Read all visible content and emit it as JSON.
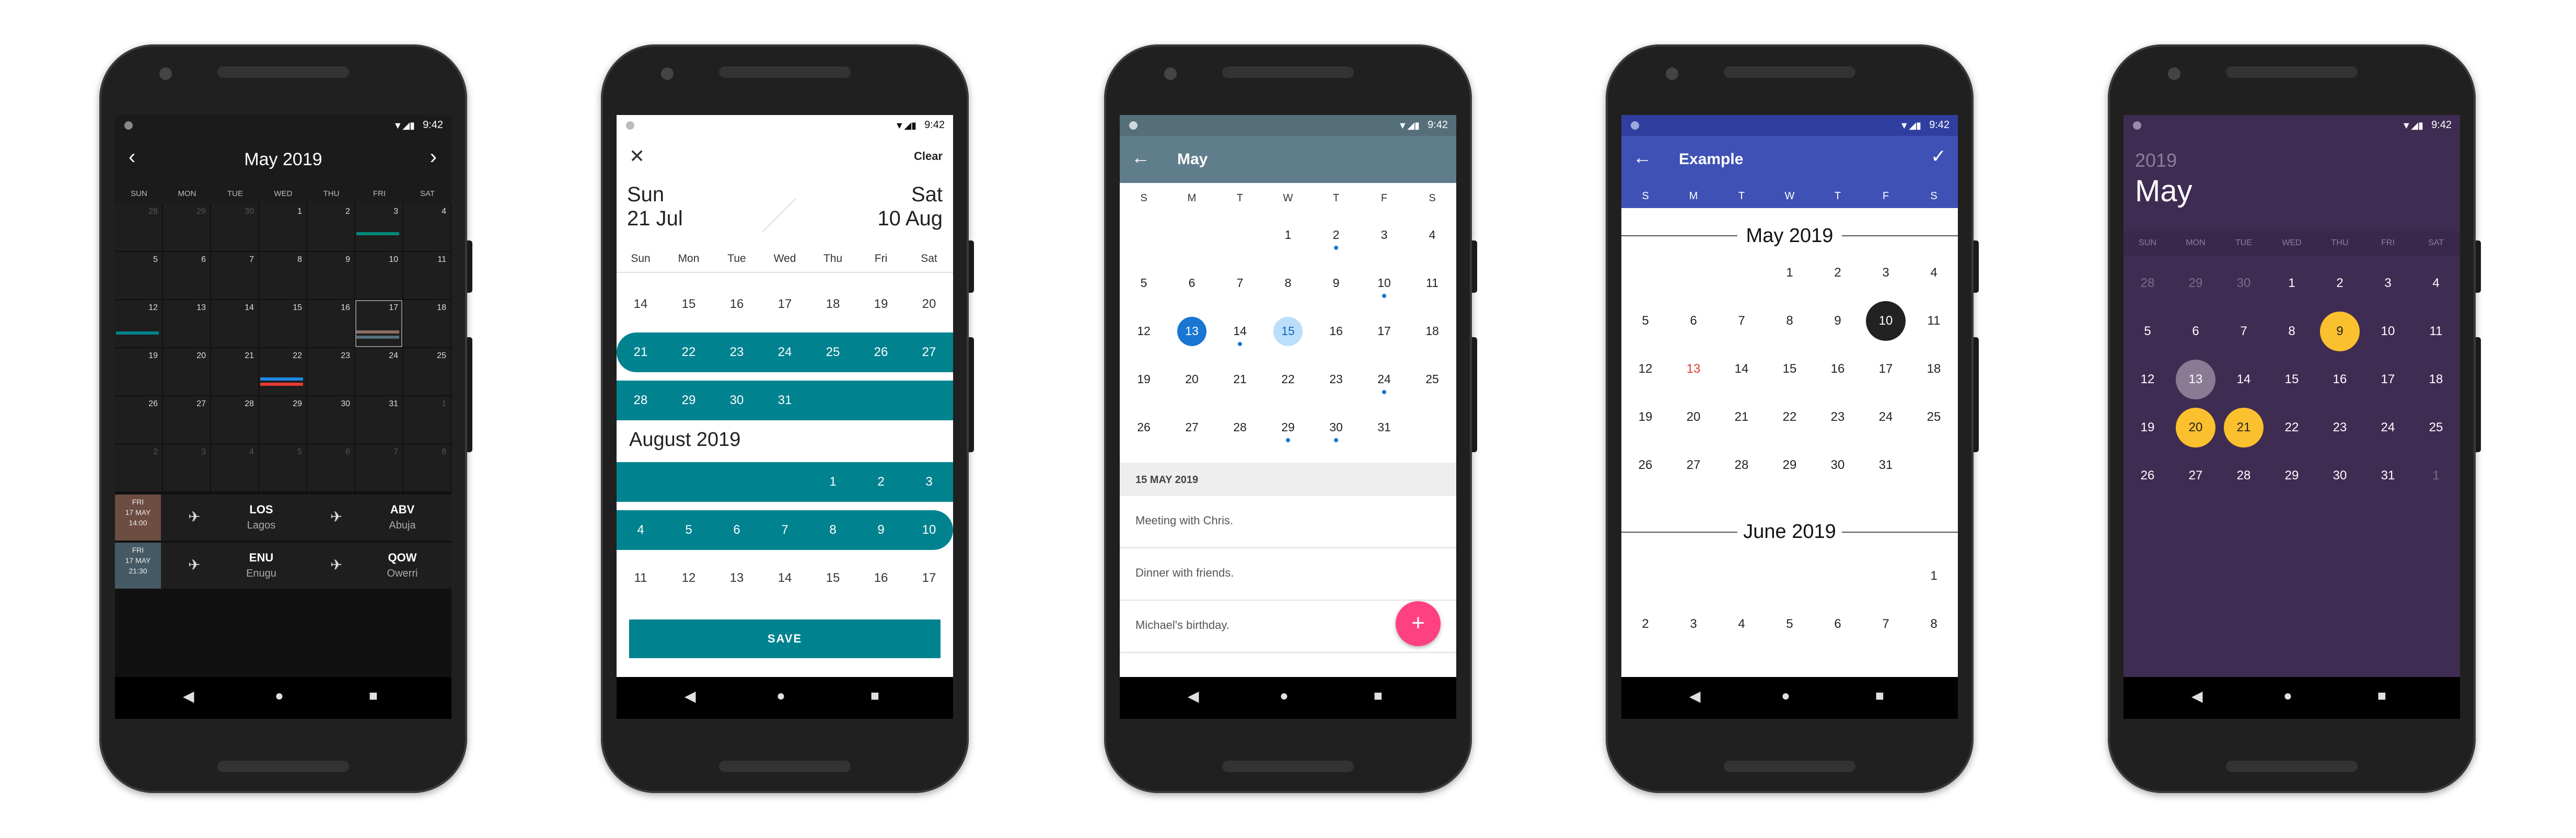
{
  "status": {
    "time": "9:42"
  },
  "dark": {
    "title": "May 2019",
    "dows": [
      "SUN",
      "MON",
      "TUE",
      "WED",
      "THU",
      "FRI",
      "SAT"
    ],
    "weeks": [
      [
        "28",
        "29",
        "30",
        "1",
        "2",
        "3",
        "4"
      ],
      [
        "5",
        "6",
        "7",
        "8",
        "9",
        "10",
        "11"
      ],
      [
        "12",
        "13",
        "14",
        "15",
        "16",
        "17",
        "18"
      ],
      [
        "19",
        "20",
        "21",
        "22",
        "23",
        "24",
        "25"
      ],
      [
        "26",
        "27",
        "28",
        "29",
        "30",
        "31",
        "1"
      ],
      [
        "2",
        "3",
        "4",
        "5",
        "6",
        "7",
        "8"
      ]
    ],
    "flights": [
      {
        "day": "FRI",
        "date": "17 MAY",
        "time": "14:00",
        "from_code": "LOS",
        "from_city": "Lagos",
        "to_code": "ABV",
        "to_city": "Abuja"
      },
      {
        "day": "FRI",
        "date": "17 MAY",
        "time": "21:30",
        "from_code": "ENU",
        "from_city": "Enugu",
        "to_code": "QOW",
        "to_city": "Owerri"
      }
    ]
  },
  "range": {
    "close_icon": "close-icon",
    "clear": "Clear",
    "start_day": "Sun",
    "start_date": "21 Jul",
    "end_day": "Sat",
    "end_date": "10 Aug",
    "dows": [
      "Sun",
      "Mon",
      "Tue",
      "Wed",
      "Thu",
      "Fri",
      "Sat"
    ],
    "jul_rows": [
      [
        "14",
        "15",
        "16",
        "17",
        "18",
        "19",
        "20"
      ],
      [
        "21",
        "22",
        "23",
        "24",
        "25",
        "26",
        "27"
      ],
      [
        "28",
        "29",
        "30",
        "31",
        "",
        "",
        ""
      ]
    ],
    "month2": "August 2019",
    "aug_rows": [
      [
        "",
        "",
        "",
        "",
        "1",
        "2",
        "3"
      ],
      [
        "4",
        "5",
        "6",
        "7",
        "8",
        "9",
        "10"
      ],
      [
        "11",
        "12",
        "13",
        "14",
        "15",
        "16",
        "17"
      ]
    ],
    "save": "SAVE",
    "accent": "#00838f"
  },
  "events": {
    "title": "May",
    "dows": [
      "S",
      "M",
      "T",
      "W",
      "T",
      "F",
      "S"
    ],
    "weeks": [
      [
        "",
        "",
        "",
        "1",
        "2",
        "3",
        "4"
      ],
      [
        "5",
        "6",
        "7",
        "8",
        "9",
        "10",
        "11"
      ],
      [
        "12",
        "13",
        "14",
        "15",
        "16",
        "17",
        "18"
      ],
      [
        "19",
        "20",
        "21",
        "22",
        "23",
        "24",
        "25"
      ],
      [
        "26",
        "27",
        "28",
        "29",
        "30",
        "31",
        ""
      ]
    ],
    "section": "15 MAY 2019",
    "items": [
      "Meeting with Chris.",
      "Dinner with friends.",
      "Michael's birthday."
    ],
    "fab": "+",
    "toolbar_color": "#607d8b",
    "fab_color": "#ff4081"
  },
  "example": {
    "title": "Example",
    "dows": [
      "S",
      "M",
      "T",
      "W",
      "T",
      "F",
      "S"
    ],
    "month1": "May 2019",
    "may_weeks": [
      [
        "",
        "",
        "",
        "1",
        "2",
        "3",
        "4"
      ],
      [
        "5",
        "6",
        "7",
        "8",
        "9",
        "10",
        "11"
      ],
      [
        "12",
        "13",
        "14",
        "15",
        "16",
        "17",
        "18"
      ],
      [
        "19",
        "20",
        "21",
        "22",
        "23",
        "24",
        "25"
      ],
      [
        "26",
        "27",
        "28",
        "29",
        "30",
        "31",
        ""
      ]
    ],
    "month2": "June 2019",
    "jun_weeks": [
      [
        "",
        "",
        "",
        "",
        "",
        "",
        "1"
      ],
      [
        "2",
        "3",
        "4",
        "5",
        "6",
        "7",
        "8"
      ]
    ],
    "toolbar_color": "#3f51b5"
  },
  "purple": {
    "year": "2019",
    "month": "May",
    "dows": [
      "SUN",
      "MON",
      "TUE",
      "WED",
      "THU",
      "FRI",
      "SAT"
    ],
    "weeks": [
      [
        "28",
        "29",
        "30",
        "1",
        "2",
        "3",
        "4"
      ],
      [
        "5",
        "6",
        "7",
        "8",
        "9",
        "10",
        "11"
      ],
      [
        "12",
        "13",
        "14",
        "15",
        "16",
        "17",
        "18"
      ],
      [
        "19",
        "20",
        "21",
        "22",
        "23",
        "24",
        "25"
      ],
      [
        "26",
        "27",
        "28",
        "29",
        "30",
        "31",
        "1"
      ]
    ],
    "bg_color": "#3f2c52",
    "highlight": "#fbc02d"
  }
}
